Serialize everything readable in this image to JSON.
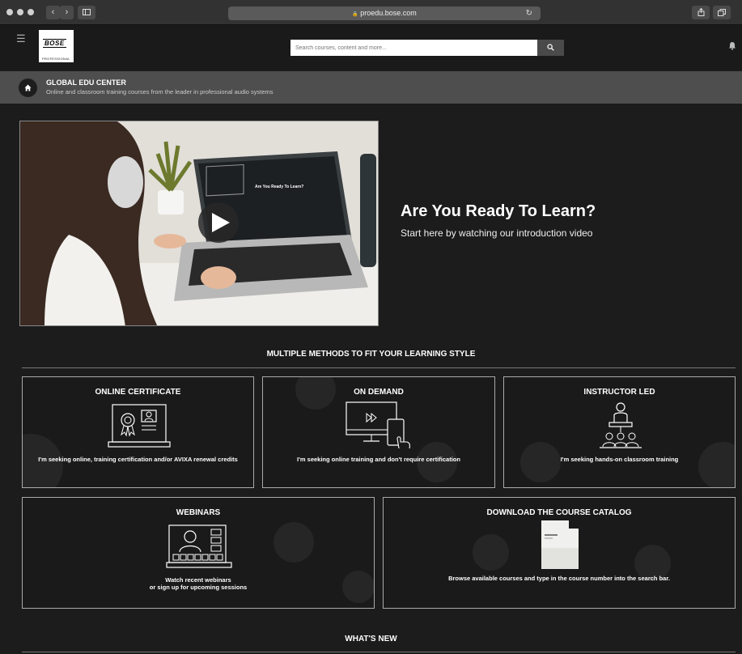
{
  "browser": {
    "url": "proedu.bose.com"
  },
  "header": {
    "logo_brand": "BOSE",
    "logo_sub": "PROFESSIONAL",
    "search_placeholder": "Search courses, content and more..."
  },
  "subheader": {
    "title": "GLOBAL EDU CENTER",
    "description": "Online and classroom training courses from the leader in professional audio systems"
  },
  "hero": {
    "title": "Are You Ready To Learn?",
    "subtitle": "Start here by watching our introduction video",
    "video_screen_text": "Are You Ready To Learn?"
  },
  "methods": {
    "heading": "MULTIPLE METHODS TO FIT YOUR LEARNING STYLE",
    "cards": [
      {
        "title": "ONLINE CERTIFICATE",
        "desc": "I'm seeking online, training certification and/or AVIXA renewal credits"
      },
      {
        "title": "ON DEMAND",
        "desc": "I'm seeking online training and don't require certification"
      },
      {
        "title": "INSTRUCTOR LED",
        "desc": "I'm seeking hands-on classroom training"
      },
      {
        "title": "WEBINARS",
        "desc_line1": "Watch recent webinars",
        "desc_line2": "or sign up for upcoming sessions"
      },
      {
        "title": "DOWNLOAD THE COURSE CATALOG",
        "desc": "Browse available courses and type in the course number into the search bar."
      }
    ]
  },
  "whats_new": {
    "heading": "WHAT'S NEW"
  },
  "icons": {
    "menu": "☰",
    "search": "🔍",
    "bell": "🔔",
    "home": "⌂",
    "play": "▶",
    "lock": "🔒",
    "reload": "↻"
  }
}
